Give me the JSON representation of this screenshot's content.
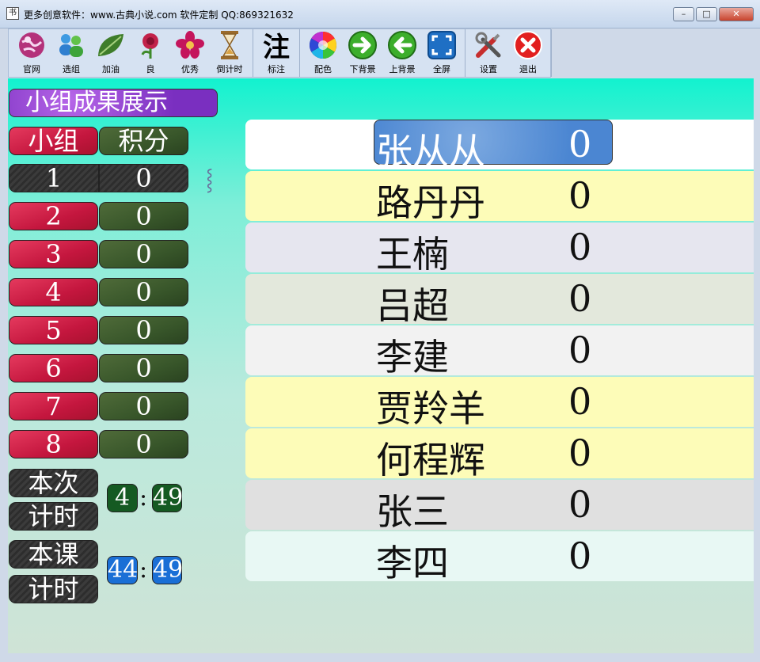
{
  "window": {
    "icon_glyph": "书",
    "title": "更多创意软件：www.古典小说.com  软件定制 QQ:869321632",
    "btn_min": "–",
    "btn_max": "□",
    "btn_close": "✕"
  },
  "toolbar": {
    "groups": [
      [
        {
          "label": "官网",
          "icon": "globe-icon"
        },
        {
          "label": "选组",
          "icon": "users-icon"
        },
        {
          "label": "加油",
          "icon": "leaf-icon"
        },
        {
          "label": "良",
          "icon": "rose-icon"
        },
        {
          "label": "优秀",
          "icon": "flower-icon"
        },
        {
          "label": "倒计时",
          "icon": "hourglass-icon"
        }
      ],
      [
        {
          "label": "标注",
          "icon": "annotate-icon",
          "glyph": "注"
        }
      ],
      [
        {
          "label": "配色",
          "icon": "color-wheel-icon"
        },
        {
          "label": "下背景",
          "icon": "arrow-right-icon"
        },
        {
          "label": "上背景",
          "icon": "arrow-left-icon"
        },
        {
          "label": "全屏",
          "icon": "fullscreen-icon"
        }
      ],
      [
        {
          "label": "设置",
          "icon": "tools-icon"
        },
        {
          "label": "退出",
          "icon": "exit-icon"
        }
      ]
    ]
  },
  "panel": {
    "title": "小组成果展示",
    "header_group": "小组",
    "header_score": "积分",
    "groups": [
      {
        "group": "1",
        "score": "0"
      },
      {
        "group": "2",
        "score": "0"
      },
      {
        "group": "3",
        "score": "0"
      },
      {
        "group": "4",
        "score": "0"
      },
      {
        "group": "5",
        "score": "0"
      },
      {
        "group": "6",
        "score": "0"
      },
      {
        "group": "7",
        "score": "0"
      },
      {
        "group": "8",
        "score": "0"
      }
    ],
    "timer1": {
      "label_a": "本次",
      "label_b": "计时",
      "min": "4",
      "sep": ":",
      "sec": "49"
    },
    "timer2": {
      "label_a": "本课",
      "label_b": "计时",
      "min": "44",
      "sep": ":",
      "sec": "49"
    }
  },
  "students": [
    {
      "name": "张从从",
      "score": "0"
    },
    {
      "name": "路丹丹",
      "score": "0"
    },
    {
      "name": "王楠",
      "score": "0"
    },
    {
      "name": "吕超",
      "score": "0"
    },
    {
      "name": "李建",
      "score": "0"
    },
    {
      "name": "贾羚羊",
      "score": "0"
    },
    {
      "name": "何程辉",
      "score": "0"
    },
    {
      "name": "张三",
      "score": "0"
    },
    {
      "name": "李四",
      "score": "0"
    }
  ],
  "row_backgrounds": [
    "#ffffff",
    "#fdfcb8",
    "#e6e6ef",
    "#e3e8dc",
    "#f2f2f2",
    "#fdfcb8",
    "#fdfcb8",
    "#e0e0e0",
    "#e8f8f4"
  ]
}
